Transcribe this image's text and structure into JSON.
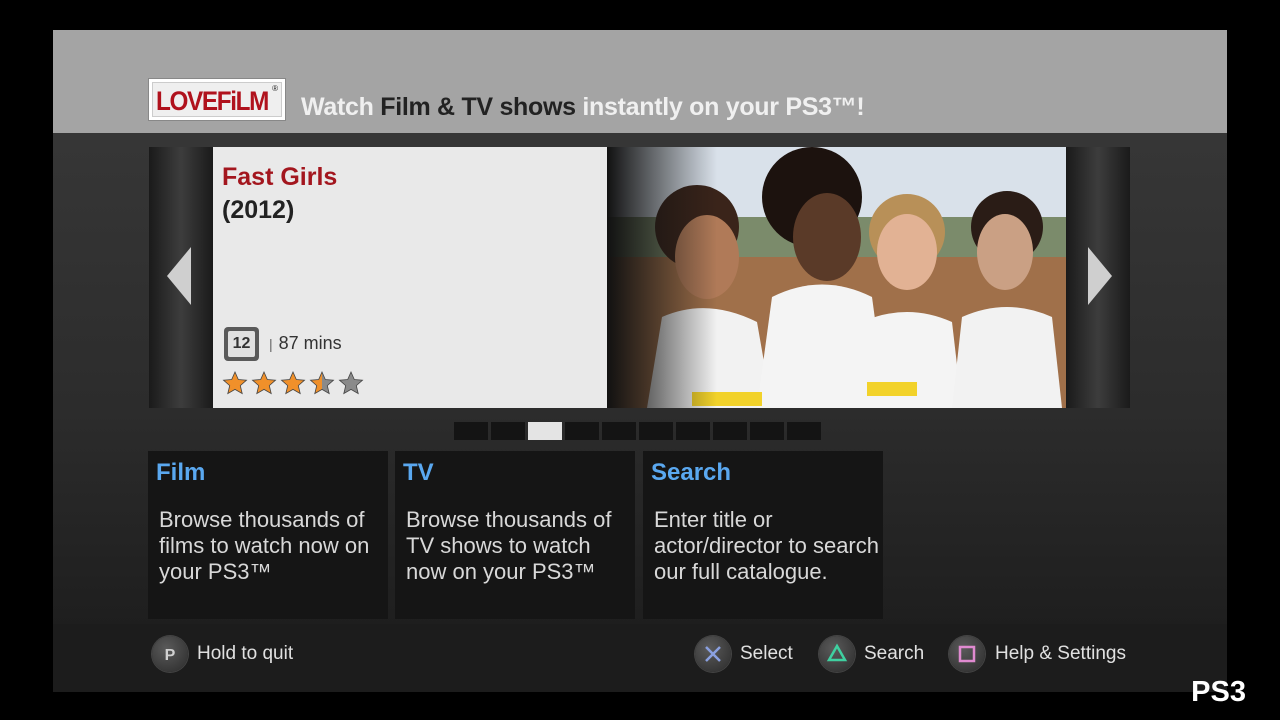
{
  "header": {
    "logo_text": "LOVEFiLM",
    "logo_reg": "®",
    "tagline_part1": "Watch ",
    "tagline_part2": "Film & TV shows",
    "tagline_part3": " instantly on your PS3™!"
  },
  "featured": {
    "title": "Fast Girls",
    "year": "(2012)",
    "certificate": "12",
    "runtime": "87 mins",
    "rating_stars": 3.5,
    "rating_max": 5,
    "prev_icon": "arrow-left-icon",
    "next_icon": "arrow-right-icon"
  },
  "carousel": {
    "page_count": 10,
    "active_page": 3
  },
  "tiles": [
    {
      "title": "Film",
      "description": "Browse thousands of films to watch now on your PS3™"
    },
    {
      "title": "TV",
      "description": "Browse thousands of TV shows to watch now on your PS3™"
    },
    {
      "title": "Search",
      "description": "Enter title or actor/director to search our full catalogue."
    }
  ],
  "footer": {
    "quit_label": "Hold to quit",
    "select_label": "Select",
    "search_label": "Search",
    "help_label": "Help & Settings"
  },
  "watermark": "PS3",
  "colors": {
    "accent_title": "#a3161e",
    "tile_title": "#5aa8f0",
    "star_fill": "#f0902a",
    "star_empty": "#8a8a8a",
    "cross": "#8aa0e0",
    "triangle": "#3fd0a0",
    "square": "#e08ad0"
  }
}
